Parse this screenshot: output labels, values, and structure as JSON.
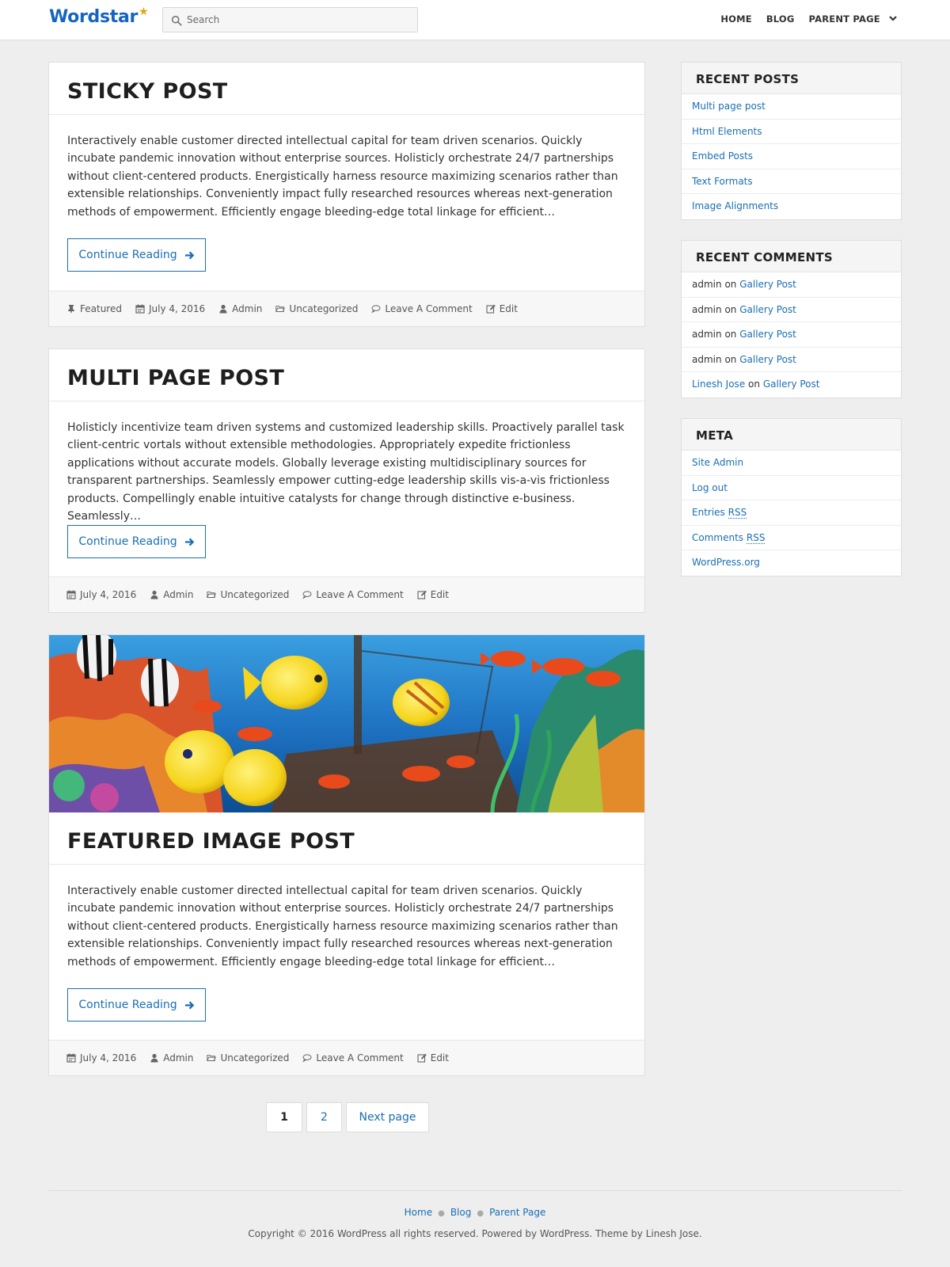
{
  "header": {
    "logo": "Wordstar",
    "search_placeholder": "Search",
    "nav": [
      "HOME",
      "BLOG",
      "PARENT PAGE"
    ]
  },
  "posts": [
    {
      "title": "STICKY POST",
      "excerpt": "Interactively enable customer directed intellectual capital for team driven scenarios. Quickly incubate pandemic innovation without enterprise sources. Holisticly orchestrate 24/7 partnerships without client-centered products. Energistically harness resource maximizing scenarios rather than extensible relationships. Conveniently impact fully researched resources whereas next-generation methods of empowerment. Efficiently engage bleeding-edge total linkage for efficient…",
      "button": "Continue Reading",
      "featured_label": "Featured",
      "date": "July 4, 2016",
      "author": "Admin",
      "category": "Uncategorized",
      "comments": "Leave A Comment",
      "edit": "Edit"
    },
    {
      "title": "MULTI PAGE POST",
      "excerpt": "Holisticly incentivize team driven systems and customized leadership skills. Proactively parallel task client-centric vortals without extensible methodologies. Appropriately expedite frictionless applications without accurate models. Globally leverage existing multidisciplinary sources for transparent partnerships. Seamlessly empower cutting-edge leadership skills vis-a-vis frictionless products. Compellingly enable intuitive catalysts for change through distinctive e-business. Seamlessly…",
      "button": "Continue Reading",
      "date": "July 4, 2016",
      "author": "Admin",
      "category": "Uncategorized",
      "comments": "Leave A Comment",
      "edit": "Edit"
    },
    {
      "title": "FEATURED IMAGE POST",
      "excerpt": "Interactively enable customer directed intellectual capital for team driven scenarios. Quickly incubate pandemic innovation without enterprise sources. Holisticly orchestrate 24/7 partnerships without client-centered products. Energistically harness resource maximizing scenarios rather than extensible relationships. Conveniently impact fully researched resources whereas next-generation methods of empowerment. Efficiently engage bleeding-edge total linkage for efficient…",
      "button": "Continue Reading",
      "date": "July 4, 2016",
      "author": "Admin",
      "category": "Uncategorized",
      "comments": "Leave A Comment",
      "edit": "Edit"
    }
  ],
  "pagination": {
    "page1": "1",
    "page2": "2",
    "next": "Next page"
  },
  "sidebar": {
    "recent_posts": {
      "title": "RECENT POSTS",
      "items": [
        "Multi page post",
        "Html Elements",
        "Embed Posts",
        "Text Formats",
        "Image Alignments"
      ]
    },
    "recent_comments": {
      "title": "RECENT COMMENTS",
      "on": "on",
      "items": [
        {
          "author": "admin",
          "post": "Gallery Post"
        },
        {
          "author": "admin",
          "post": "Gallery Post"
        },
        {
          "author": "admin",
          "post": "Gallery Post"
        },
        {
          "author": "admin",
          "post": "Gallery Post"
        },
        {
          "author": "Linesh Jose",
          "post": "Gallery Post"
        }
      ]
    },
    "meta": {
      "title": "META",
      "site_admin": "Site Admin",
      "log_out": "Log out",
      "entries": "Entries",
      "comments": "Comments",
      "rss": "RSS",
      "wordpress": "WordPress.org"
    }
  },
  "footer": {
    "nav": [
      "Home",
      "Blog",
      "Parent Page"
    ],
    "copyright": "Copyright © 2016 WordPress all rights reserved. Powered by WordPress. Theme by Linesh Jose."
  },
  "colors": {
    "link": "#1a6eb5",
    "logo": "#1565c0",
    "logo_star": "#e8a20c",
    "background": "#eeeeee"
  },
  "icons": [
    "search-icon",
    "chevron-down-icon",
    "arrow-right-icon",
    "pin-icon",
    "calendar-icon",
    "user-icon",
    "folder-icon",
    "comment-icon",
    "edit-icon",
    "star-icon"
  ]
}
